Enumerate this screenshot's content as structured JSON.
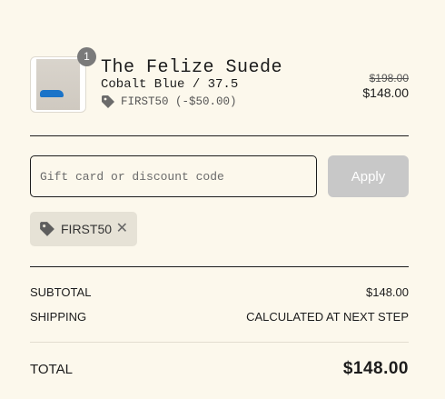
{
  "product": {
    "quantity": "1",
    "name": "The Felize Suede",
    "variant": "Cobalt Blue / 37.5",
    "discount_line": "FIRST50 (-$50.00)",
    "price_original": "$198.00",
    "price_final": "$148.00"
  },
  "discount_form": {
    "placeholder": "Gift card or discount code",
    "value": "",
    "apply_label": "Apply"
  },
  "applied_code": {
    "label": "FIRST50"
  },
  "summary": {
    "subtotal_label": "SUBTOTAL",
    "subtotal_value": "$148.00",
    "shipping_label": "SHIPPING",
    "shipping_value": "CALCULATED AT NEXT STEP",
    "total_label": "TOTAL",
    "total_value": "$148.00"
  },
  "icons": {
    "tag": "tag-icon",
    "remove": "close-icon"
  },
  "colors": {
    "background": "#fcf8ec",
    "apply_button": "#c8c8c8",
    "chip": "#e6e2d6",
    "badge": "#7a7a7a",
    "shoe": "#1a73c8"
  }
}
